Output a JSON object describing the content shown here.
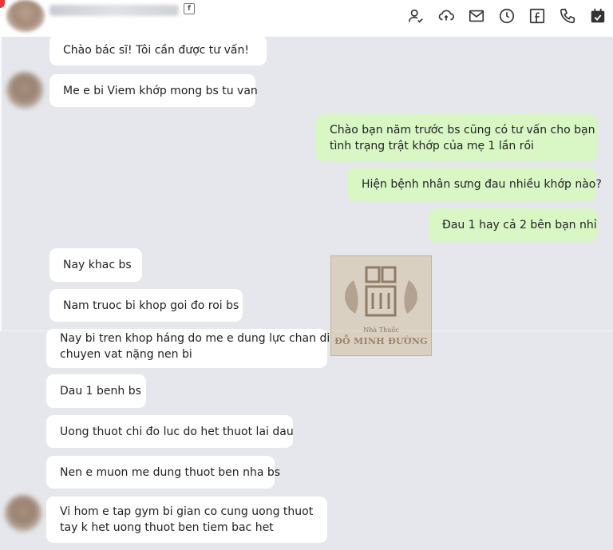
{
  "header": {
    "icons": [
      "user-check-icon",
      "cloud-sync-icon",
      "mail-icon",
      "clock-icon",
      "facebook-icon",
      "phone-icon",
      "calendar-check-icon"
    ]
  },
  "watermark": {
    "subtitle": "Nhà Thuốc",
    "brand": "ĐỖ MINH ĐƯỜNG"
  },
  "messages": [
    {
      "side": "in",
      "lines": [
        "Chào bác sĩ! Tôi cần được tư vấn!"
      ]
    },
    {
      "side": "in",
      "lines": [
        "Me e bi Viem khớp mong bs tu van"
      ]
    },
    {
      "side": "out",
      "lines": [
        "Chào bạn năm trước bs cũng có tư vấn cho bạn",
        "tình trạng trật khớp của mẹ 1 lần rồi"
      ]
    },
    {
      "side": "out",
      "lines": [
        "Hiện bệnh nhân sưng đau nhiều khớp nào?"
      ]
    },
    {
      "side": "out",
      "lines": [
        "Đau 1 hay cả 2 bên bạn nhỉ"
      ]
    },
    {
      "side": "in",
      "lines": [
        "Nay khac bs"
      ]
    },
    {
      "side": "in",
      "lines": [
        "Nam truoc bi khop goi đo roi bs"
      ]
    },
    {
      "side": "in",
      "lines": [
        "Nay bi tren khop háng do me e dung lực chan di",
        "chuyen vat nặng nen bi"
      ]
    },
    {
      "side": "in",
      "lines": [
        "Dau 1 benh bs"
      ]
    },
    {
      "side": "in",
      "lines": [
        "Uong thuot chi đo luc do het thuot lai dau"
      ]
    },
    {
      "side": "in",
      "lines": [
        "Nen e muon me dung thuot ben nha bs"
      ]
    },
    {
      "side": "in",
      "lines": [
        "Vi hom e tap gym bi gian co cung uong thuot",
        "tay k het uong thuot ben tiem bac het"
      ]
    }
  ]
}
